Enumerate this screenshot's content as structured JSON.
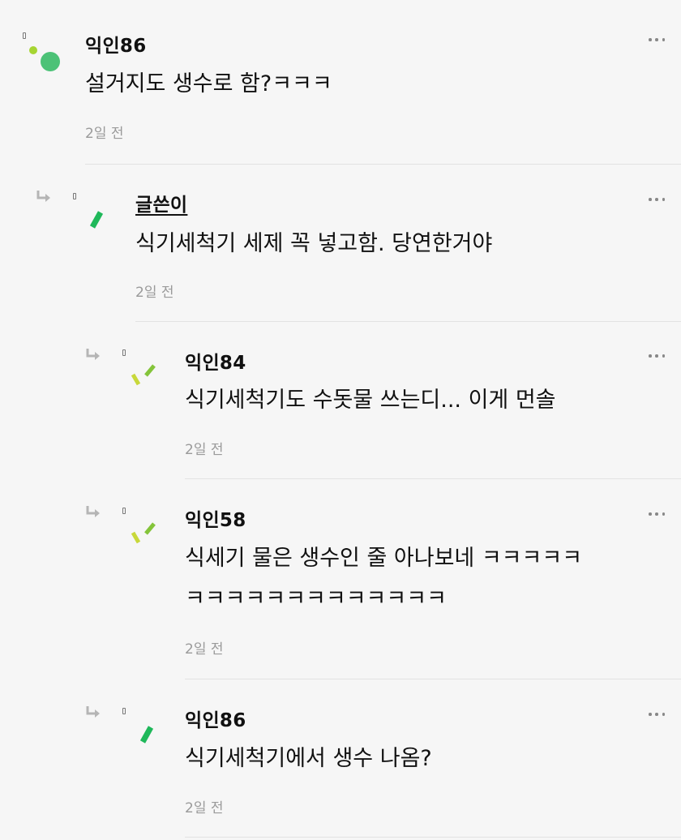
{
  "comments": [
    {
      "author": "익인86",
      "text": "설거지도 생수로 함?ㅋㅋㅋ",
      "time": "2일 전",
      "is_op": false
    },
    {
      "author": "글쓴이",
      "text": "식기세척기 세제 꼭 넣고함. 당연한거야",
      "time": "2일 전",
      "is_op": true
    },
    {
      "author": "익인84",
      "text": "식기세척기도 수돗물 쓰는디... 이게 먼솔",
      "time": "2일 전",
      "is_op": false
    },
    {
      "author": "익인58",
      "text_line1": "식세기 물은 생수인 줄 아나보네 ㅋㅋㅋㅋㅋ",
      "text_line2": "ㅋㅋㅋㅋㅋㅋㅋㅋㅋㅋㅋㅋㅋ",
      "time": "2일 전",
      "is_op": false
    },
    {
      "author": "익인86",
      "text": "식기세척기에서 생수 나옴?",
      "time": "2일 전",
      "is_op": false
    }
  ],
  "colors": {
    "bright_green": "#1fb85a",
    "lime": "#c8d83a",
    "mint_dot": "#4cc277",
    "lime_dot": "#a6d532"
  }
}
